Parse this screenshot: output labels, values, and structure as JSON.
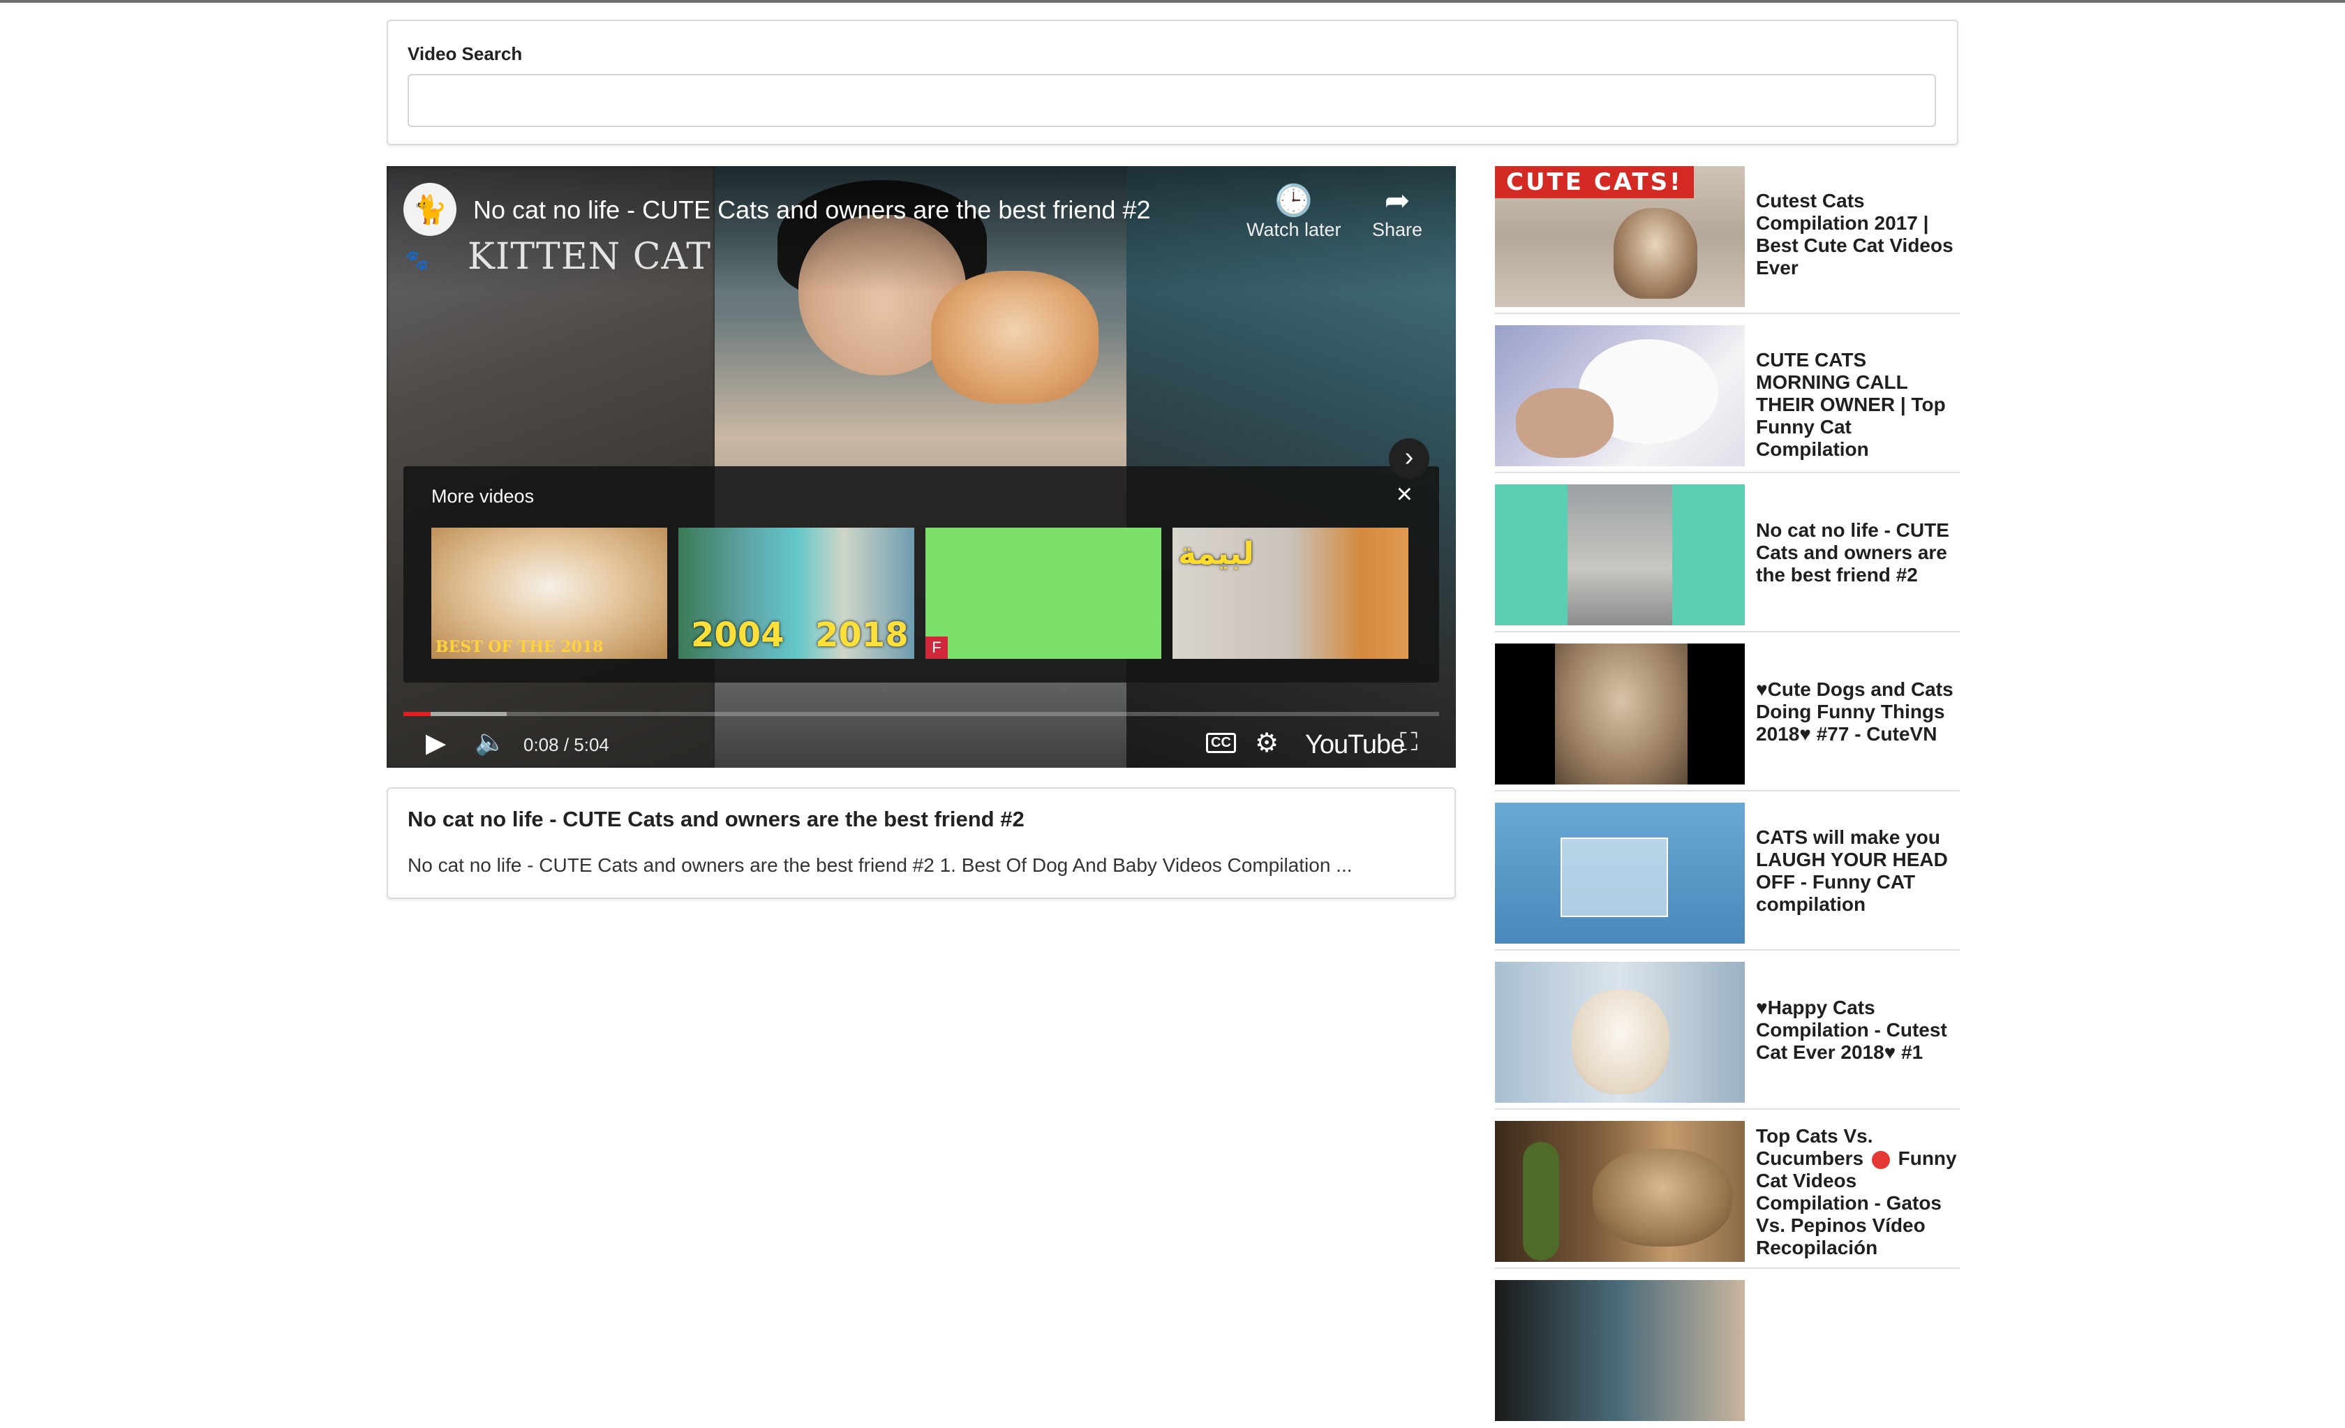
{
  "search": {
    "label": "Video Search",
    "value": "",
    "placeholder": ""
  },
  "player": {
    "title": "No cat no life - CUTE Cats and owners are the best friend #2",
    "channel_watermark": "KITTEN CAT",
    "watch_later_label": "Watch later",
    "share_label": "Share",
    "more_videos_label": "More videos",
    "close_icon": "×",
    "thumbs": [
      {
        "text": "BEST OF THE 2018"
      },
      {
        "text_a": "2004",
        "text_b": "2018"
      },
      {
        "badge": "F"
      },
      {
        "text": "لبيمة"
      }
    ],
    "next_icon": "›",
    "time": "0:08 / 5:04",
    "progress_played": 0.026,
    "progress_buffered": 0.1,
    "cc_label": "CC",
    "youtube_label": "YouTube",
    "accent": "#e02020"
  },
  "description": {
    "title": "No cat no life - CUTE Cats and owners are the best friend #2",
    "text": "No cat no life - CUTE Cats and owners are the best friend #2 1. Best Of Dog And Baby Videos Compilation ..."
  },
  "sidebar": {
    "items": [
      {
        "title": "Cutest Cats Compilation 2017 | Best Cute Cat Videos Ever",
        "banner": "CUTE CATS!"
      },
      {
        "title": "CUTE CATS MORNING CALL THEIR OWNER | Top Funny Cat Compilation"
      },
      {
        "title": "No cat no life - CUTE Cats and owners are the best friend #2"
      },
      {
        "title": "♥Cute Dogs and Cats Doing Funny Things 2018♥ #77 - CuteVN"
      },
      {
        "title": "CATS will make you LAUGH YOUR HEAD OFF - Funny CAT compilation"
      },
      {
        "title": "♥Happy Cats Compilation - Cutest Cat Ever 2018♥ #1"
      },
      {
        "title_a": "Top Cats Vs. Cucumbers",
        "title_b": "Funny Cat Videos Compilation - Gatos Vs. Pepinos Vídeo Recopilación"
      },
      {
        "title": ""
      }
    ]
  }
}
